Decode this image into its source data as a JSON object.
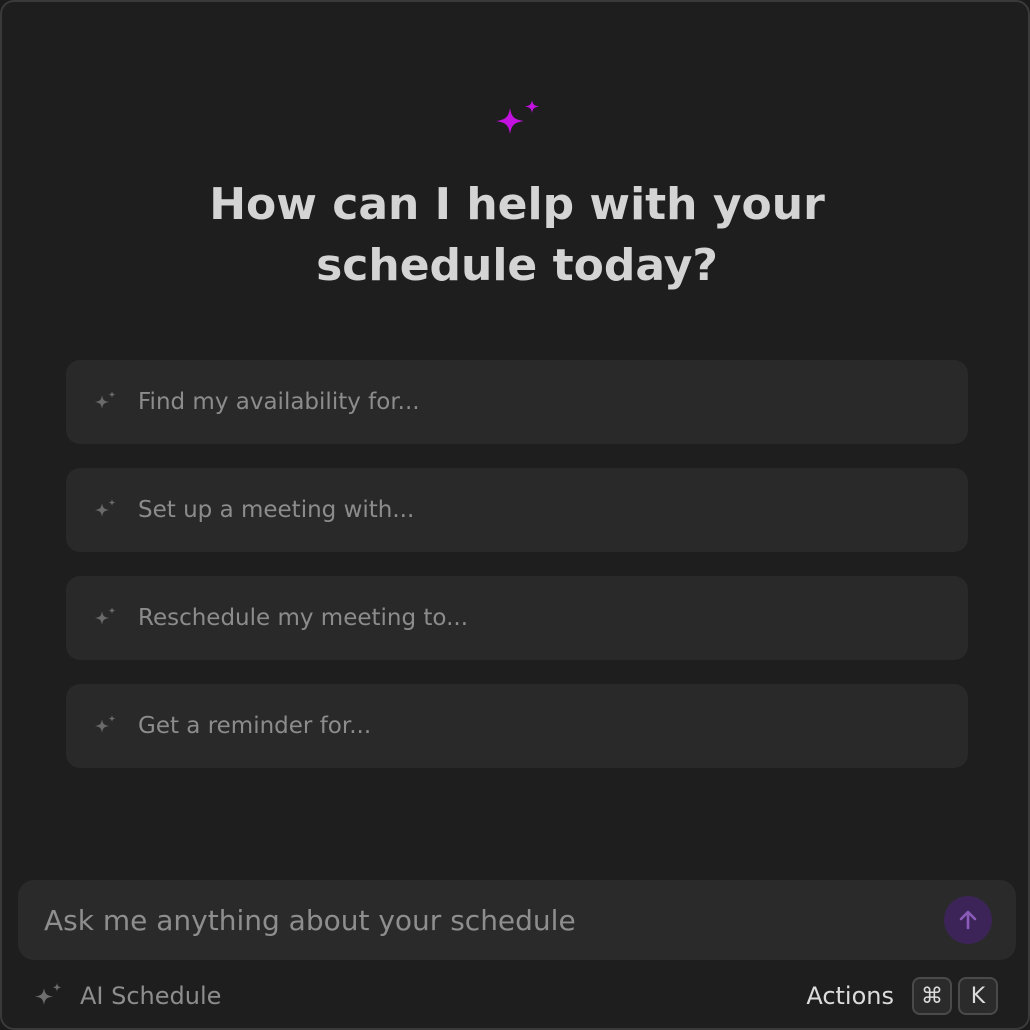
{
  "hero": {
    "icon": "sparkles-icon",
    "icon_color": "#c312e0",
    "heading": "How can I help with your schedule today?"
  },
  "suggestions": [
    {
      "icon": "sparkles-icon",
      "label": "Find my availability for..."
    },
    {
      "icon": "sparkles-icon",
      "label": "Set up a meeting with..."
    },
    {
      "icon": "sparkles-icon",
      "label": "Reschedule my meeting to..."
    },
    {
      "icon": "sparkles-icon",
      "label": "Get a reminder for..."
    }
  ],
  "input": {
    "placeholder": "Ask me anything about your schedule",
    "value": "",
    "send_icon": "arrow-up-icon",
    "send_color": "#3c2459"
  },
  "footer": {
    "brand_icon": "sparkles-icon",
    "brand_label": "AI Schedule",
    "actions_label": "Actions",
    "shortcut_keys": [
      "⌘",
      "K"
    ]
  },
  "colors": {
    "background": "#1e1e1e",
    "card": "#292929",
    "accent": "#c312e0"
  }
}
